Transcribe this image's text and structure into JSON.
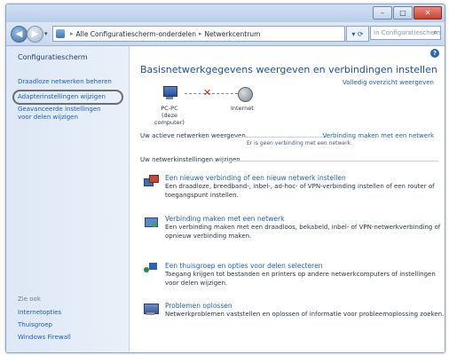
{
  "window": {
    "minimize_label": "–",
    "maximize_label": "□",
    "close_label": "✕"
  },
  "navbar": {
    "back_label": "◀",
    "forward_label": "▶",
    "history_label": "▾",
    "breadcrumbs": [
      "Alle Configuratiescherm-onderdelen",
      "Netwerkcentrum"
    ],
    "separator": "▸",
    "refresh_label": "▾ ⟳",
    "search_placeholder": "In Configuratiescherm zoeken",
    "search_icon": "⌕"
  },
  "sidebar": {
    "home": "Configuratiescherm",
    "links": [
      "Draadloze netwerken beheren",
      "Adapterinstellingen wijzigen",
      "Geavanceerde instellingen",
      "voor delen wijzigen"
    ],
    "see_also_label": "Zie ook",
    "see_also": [
      "Internetopties",
      "Thuisgroep",
      "Windows Firewall"
    ]
  },
  "main": {
    "help_label": "?",
    "title": "Basisnetwerkgegevens weergeven en verbindingen instellen",
    "full_map_link": "Volledig overzicht weergeven",
    "map": {
      "computer_label": "PC-PC",
      "computer_sub": "(deze computer)",
      "internet_label": "Internet",
      "broken_marker": "✕"
    },
    "active_networks_label": "Uw actieve netwerken weergeven",
    "active_networks_link": "Verbinding maken met een netwerk",
    "no_connection_text": "Er is geen verbinding met een netwerk.",
    "change_settings_label": "Uw netwerkinstellingen wijzigen",
    "tasks": [
      {
        "link": "Een nieuwe verbinding of een nieuw netwerk instellen",
        "desc": "Een draadloze, breedband-, inbel-, ad-hoc- of VPN-verbinding instellen of een router of toegangspunt instellen."
      },
      {
        "link": "Verbinding maken met een netwerk",
        "desc": "Een verbinding maken met een draadloos, bekabeld, inbel- of VPN-netwerkverbinding of opnieuw verbinding maken."
      },
      {
        "link": "Een thuisgroep en opties voor delen selecteren",
        "desc": "Toegang krijgen tot bestanden en printers op andere netwerkcomputers of instellingen voor delen wijzigen."
      },
      {
        "link": "Problemen oplossen",
        "desc": "Netwerkproblemen vaststellen en oplossen of informatie voor probleemoplossing zoeken."
      }
    ]
  }
}
